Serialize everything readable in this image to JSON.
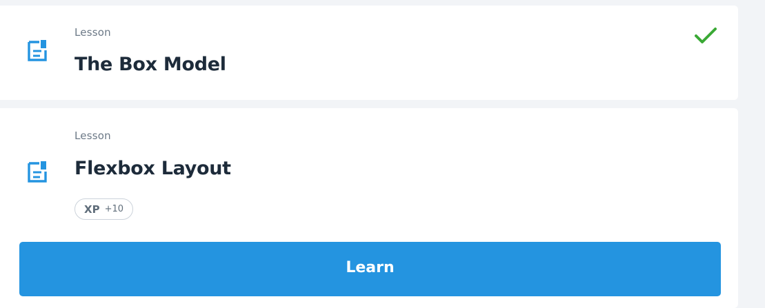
{
  "lessons": [
    {
      "kind": "Lesson",
      "title": "The Box Model",
      "icon": "document-icon",
      "status": "completed",
      "status_icon": "checkmark-icon",
      "status_color": "#3aa935"
    },
    {
      "kind": "Lesson",
      "title": "Flexbox Layout",
      "icon": "document-icon",
      "xp_label": "XP",
      "xp_value": "+10",
      "action_label": "Learn"
    }
  ],
  "colors": {
    "accent": "#2494e0",
    "icon": "#2494e0",
    "background": "#f2f4f7",
    "card": "#ffffff",
    "text": "#1d2b3a",
    "muted_text": "#6b7886"
  }
}
